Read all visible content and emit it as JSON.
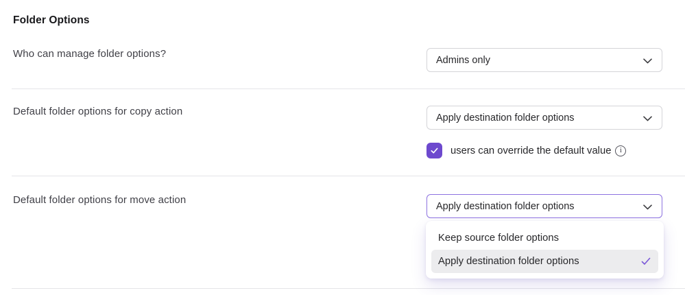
{
  "title": "Folder Options",
  "colors": {
    "accent_purple": "#6d49ce",
    "focus_border_purple": "#8d72e0",
    "check_purple": "#7a58d8",
    "select_border": "#d4d4d8",
    "divider": "#e4e4e8",
    "menu_highlight_bg": "#ececee",
    "title_text": "#18181b",
    "label_text": "#3f3f46",
    "value_text": "#27272a"
  },
  "rows": [
    {
      "label": "Who can manage folder options?",
      "select": {
        "value": "Admins only",
        "icon": "chevron-down",
        "state": "closed"
      }
    },
    {
      "label": "Default folder options for copy action",
      "select": {
        "value": "Apply destination folder options",
        "icon": "chevron-down",
        "state": "closed"
      },
      "override": {
        "checked": true,
        "label": "users can override the default value",
        "info_icon": "info-circle"
      }
    },
    {
      "label": "Default folder options for move action",
      "select": {
        "value": "Apply destination folder options",
        "icon": "chevron-down",
        "state": "open"
      },
      "dropdown": {
        "items": [
          {
            "label": "Keep source folder options",
            "selected": false
          },
          {
            "label": "Apply destination folder options",
            "selected": true
          }
        ]
      }
    }
  ]
}
